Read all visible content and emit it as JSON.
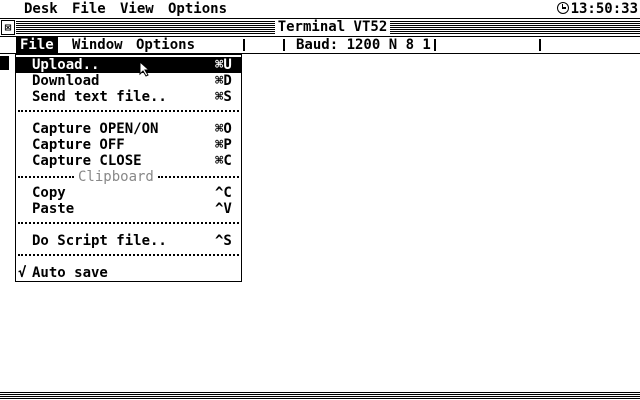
{
  "desktop_menu": {
    "items": [
      "Desk",
      "File",
      "View",
      "Options"
    ],
    "clock": "13:50:33"
  },
  "window": {
    "title": "Terminal VT52",
    "close_glyph": "⊠"
  },
  "window_menu": {
    "items": [
      "File",
      "Window",
      "Options"
    ],
    "active_item": "File",
    "baud_status": "Baud: 1200 N 8 1"
  },
  "file_menu": {
    "items": [
      {
        "label": "Upload..",
        "shortcut": "⌘U",
        "highlighted": true
      },
      {
        "label": "Download",
        "shortcut": "⌘D"
      },
      {
        "label": "Send text file..",
        "shortcut": "⌘S"
      },
      {
        "label": "Capture OPEN/ON",
        "shortcut": "⌘O"
      },
      {
        "label": "Capture OFF",
        "shortcut": "⌘P"
      },
      {
        "label": "Capture CLOSE",
        "shortcut": "⌘C"
      },
      {
        "label": "Copy",
        "shortcut": "^C"
      },
      {
        "label": "Paste",
        "shortcut": "^V"
      },
      {
        "label": "Do Script file..",
        "shortcut": "^S"
      },
      {
        "label": "Auto save",
        "check": "√"
      }
    ],
    "group_label": "Clipboard"
  },
  "colors": {
    "foreground": "#000000",
    "background": "#ffffff",
    "disabled": "#888888"
  }
}
